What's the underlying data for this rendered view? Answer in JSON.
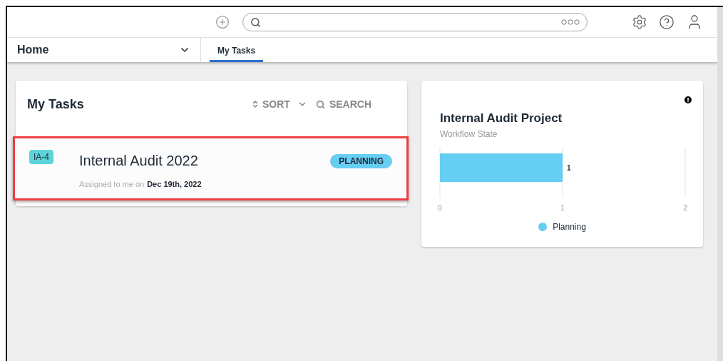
{
  "nav": {
    "module": "Home",
    "tabs": [
      {
        "label": "My Tasks",
        "selected": true
      }
    ]
  },
  "tasks_card": {
    "title": "My Tasks",
    "sort": "SORT",
    "search": "SEARCH",
    "tasks": [
      {
        "code": "IA-4",
        "name": "Internal Audit 2022",
        "status": "PLANNING",
        "assigned_prefix": "Assigned to me on",
        "assigned_date": "Dec 19th, 2022",
        "highlighted": true
      }
    ]
  },
  "chart_card": {
    "title": "Internal Audit Project",
    "subtitle": "Workflow State",
    "chart_data": {
      "type": "bar",
      "orientation": "horizontal",
      "series": [
        {
          "name": "Planning",
          "color": "#66cdf3",
          "values": [
            1
          ]
        }
      ],
      "xlim": [
        0,
        2
      ],
      "xticks": [
        0,
        1,
        2
      ],
      "data_labels": true
    }
  }
}
